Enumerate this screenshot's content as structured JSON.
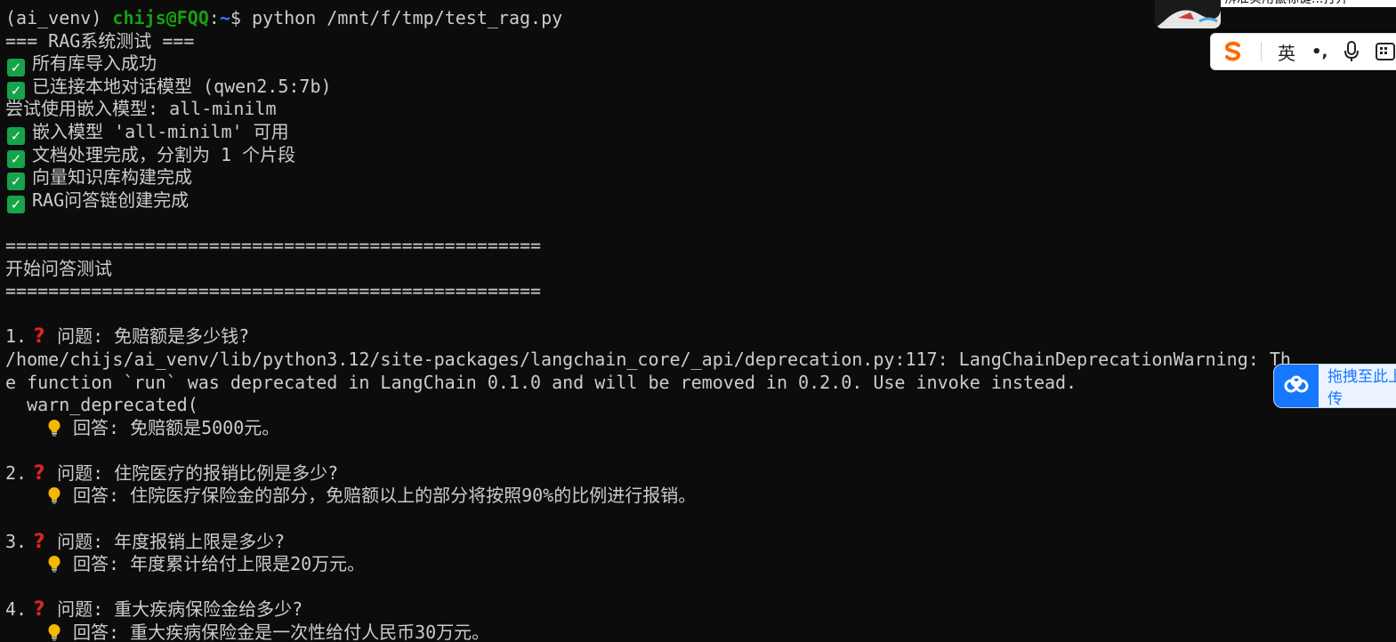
{
  "terminal": {
    "prompt": {
      "env": "(ai_venv) ",
      "user_host": "chijs@FQQ",
      "colon": ":",
      "path": "~",
      "dollar": "$ ",
      "command": "python /mnt/f/tmp/test_rag.py"
    },
    "header": "=== RAG系统测试 ===",
    "status": [
      "所有库导入成功",
      "已连接本地对话模型 (qwen2.5:7b)"
    ],
    "embed_try": "尝试使用嵌入模型: all-minilm",
    "status2": [
      "嵌入模型 'all-minilm' 可用",
      "文档处理完成，分割为 1 个片段",
      "向量知识库构建完成",
      "RAG问答链创建完成"
    ],
    "divider": "==================================================",
    "section_title": "开始问答测试",
    "warning": {
      "line1": "/home/chijs/ai_venv/lib/python3.12/site-packages/langchain_core/_api/deprecation.py:117: LangChainDeprecationWarning: Th",
      "line2": "e function `run` was deprecated in LangChain 0.1.0 and will be removed in 0.2.0. Use invoke instead.",
      "line3": "  warn_deprecated("
    },
    "qa": [
      {
        "num": "1.",
        "question": "问题: 免赔额是多少钱?",
        "answer": "回答: 免赔额是5000元。"
      },
      {
        "num": "2.",
        "question": "问题: 住院医疗的报销比例是多少?",
        "answer": "回答: 住院医疗保险金的部分，免赔额以上的部分将按照90%的比例进行报销。"
      },
      {
        "num": "3.",
        "question": "问题: 年度报销上限是多少?",
        "answer": "回答: 年度累计给付上限是20万元。"
      },
      {
        "num": "4.",
        "question": "问题: 重大疾病保险金给多少?",
        "answer": "回答: 重大疾病保险金是一次性给付人民币30万元。"
      }
    ]
  },
  "ime_toolbar": {
    "language": "英",
    "punct": "•,",
    "icons": [
      "sogou-logo-icon",
      "microphone-icon",
      "keyboard-icon"
    ]
  },
  "top_overlay": {
    "text": "辨准实用鼠标键...打开"
  },
  "drag_widget": {
    "label": "拖拽至此上传"
  },
  "colors": {
    "background": "#0c0c0c",
    "text": "#cccccc",
    "prompt_user": "#13a10e",
    "prompt_path": "#3b78ff",
    "check_bg": "#16a34a",
    "question_mark": "#e02424",
    "bulb": "#f5b800",
    "sogou": "#ff6a00",
    "drag_accent": "#1677ff"
  }
}
